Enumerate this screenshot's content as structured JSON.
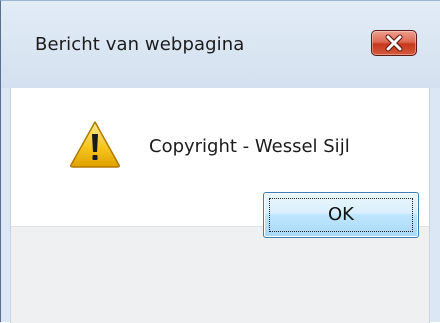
{
  "dialog": {
    "title": "Bericht van webpagina",
    "message": "Copyright - Wessel Sijl",
    "ok_label": "OK",
    "close_icon": "close-icon",
    "warning_icon": "warning-icon"
  },
  "colors": {
    "close_button": "#c8371d",
    "warning_fill": "#f5c21b",
    "ok_button_border": "#3c7fb1"
  }
}
